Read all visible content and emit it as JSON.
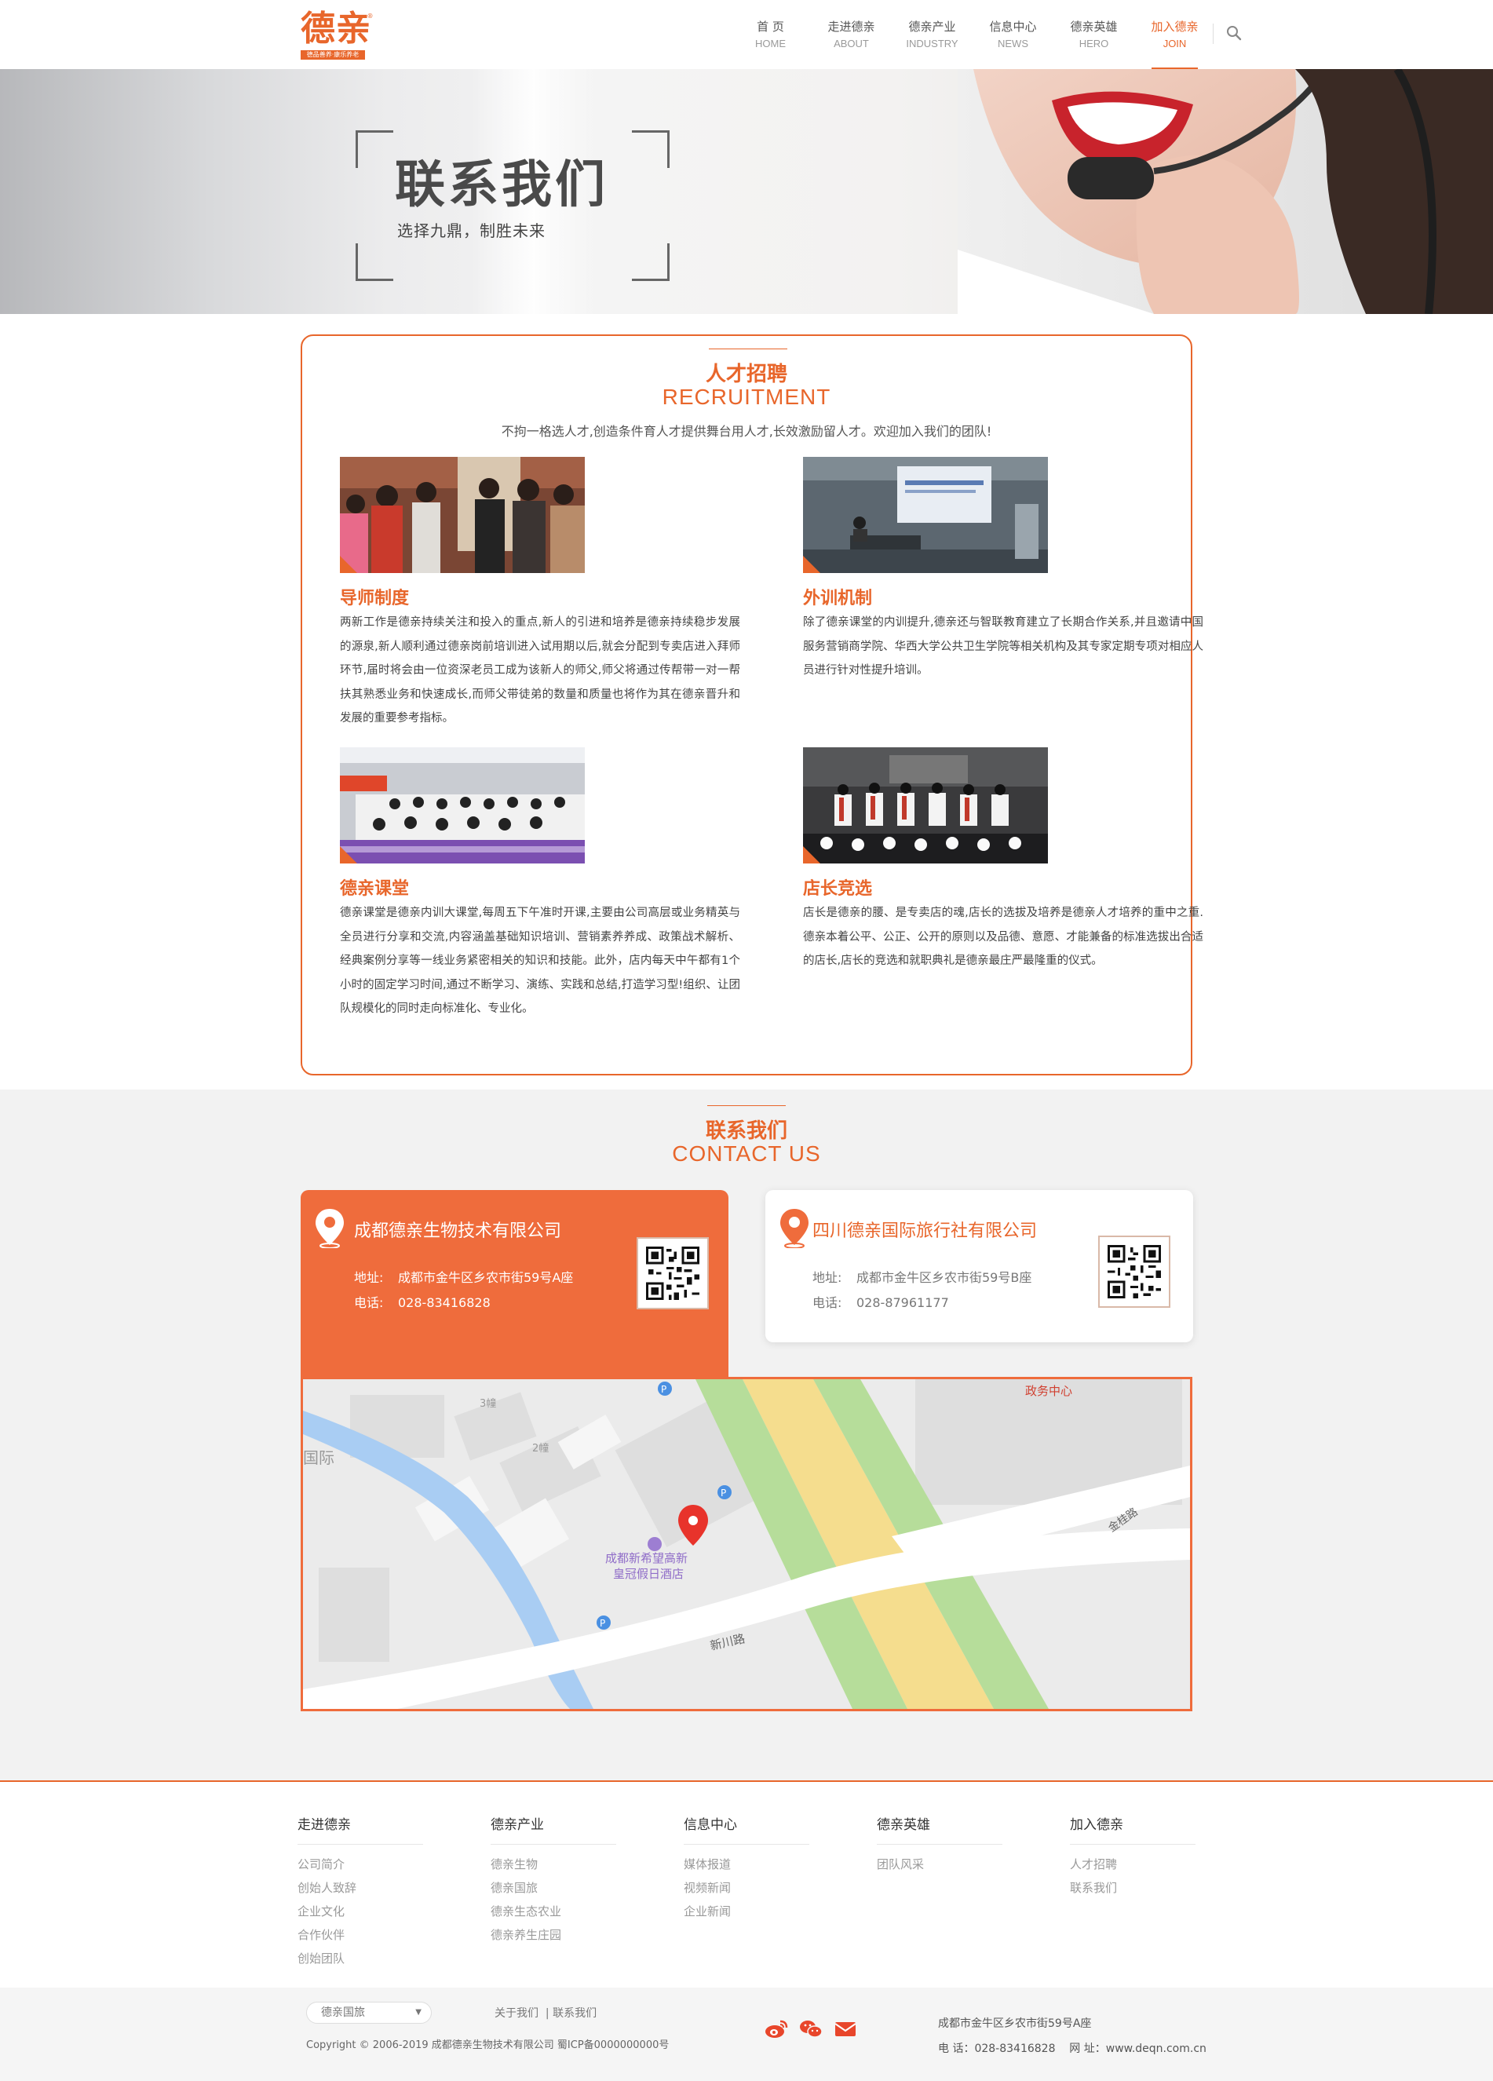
{
  "header": {
    "logo_text": "德亲",
    "logo_tagline": "德品善养·康乐养老",
    "logo_reg": "®",
    "nav": [
      {
        "cn": "首 页",
        "en": "HOME"
      },
      {
        "cn": "走进德亲",
        "en": "ABOUT"
      },
      {
        "cn": "德亲产业",
        "en": "INDUSTRY"
      },
      {
        "cn": "信息中心",
        "en": "NEWS"
      },
      {
        "cn": "德亲英雄",
        "en": "HERO"
      },
      {
        "cn": "加入德亲",
        "en": "JOIN"
      }
    ],
    "active_nav": "JOIN"
  },
  "banner": {
    "title": "联系我们",
    "subtitle": "选择九鼎，制胜未来"
  },
  "recruitment": {
    "title_cn": "人才招聘",
    "title_en": "RECRUITMENT",
    "description": "不拘一格选人才,创造条件育人才提供舞台用人才,长效激励留人才。欢迎加入我们的团队!",
    "items": [
      {
        "title": "导师制度",
        "text": "两新工作是德亲持续关注和投入的重点,新人的引进和培养是德亲持续稳步发展的源泉,新人顺利通过德亲岗前培训进入试用期以后,就会分配到专卖店进入拜师环节,届时将会由一位资深老员工成为该新人的师父,师父将通过传帮带一对一帮扶其熟悉业务和快速成长,而师父带徒弟的数量和质量也将作为其在德亲晋升和发展的重要参考指标。"
      },
      {
        "title": "外训机制",
        "text": "除了德亲课堂的内训提升,德亲还与智联教育建立了长期合作关系,并且邀请中国服务营销商学院、华西大学公共卫生学院等相关机构及其专家定期专项对相应人员进行针对性提升培训。"
      },
      {
        "title": "德亲课堂",
        "text": "德亲课堂是德亲内训大课堂,每周五下午准时开课,主要由公司高层或业务精英与全员进行分享和交流,内容涵盖基础知识培训、营销素养养成、政策战术解析、经典案例分享等一线业务紧密相关的知识和技能。此外，店内每天中午都有1个小时的固定学习时间,通过不断学习、演练、实践和总结,打造学习型!组织、让团队规模化的同时走向标准化、专业化。"
      },
      {
        "title": "店长竞选",
        "text": "店长是德亲的腰、是专卖店的魂,店长的选拔及培养是德亲人才培养的重中之重.德亲本着公平、公正、公开的原则以及品德、意愿、才能兼备的标准选拔出合适的店长,店长的竞选和就职典礼是德亲最庄严最隆重的仪式。"
      }
    ]
  },
  "contact": {
    "title_cn": "联系我们",
    "title_en": "CONTACT US",
    "companies": [
      {
        "name": "成都德亲生物技术有限公司",
        "address_label": "地址:",
        "address": "成都市金牛区乡农市街59号A座",
        "phone_label": "电话:",
        "phone": "028-83416828"
      },
      {
        "name": "四川德亲国际旅行社有限公司",
        "address_label": "地址:",
        "address": "成都市金牛区乡农市街59号B座",
        "phone_label": "电话:",
        "phone": "028-87961177"
      }
    ],
    "map": {
      "poi_name_line1": "成都新希望高新",
      "poi_name_line2": "皇冠假日酒店",
      "label_top_right_1": "政务中心",
      "label_left": "国际",
      "label_road_1": "新川路",
      "label_road_2": "金桂路",
      "label_bldg_3": "3幢",
      "label_bldg_2": "2幢"
    }
  },
  "footer": {
    "columns": [
      {
        "title": "走进德亲",
        "items": [
          "公司简介",
          "创始人致辞",
          "企业文化",
          "合作伙伴",
          "创始团队"
        ]
      },
      {
        "title": "德亲产业",
        "items": [
          "德亲生物",
          "德亲国旅",
          "德亲生态农业",
          "德亲养生庄园"
        ]
      },
      {
        "title": "信息中心",
        "items": [
          "媒体报道",
          "视频新闻",
          "企业新闻"
        ]
      },
      {
        "title": "德亲英雄",
        "items": [
          "团队风采"
        ]
      },
      {
        "title": "加入德亲",
        "items": [
          "人才招聘",
          "联系我们"
        ]
      }
    ],
    "select_value": "德亲国旅",
    "links": [
      "关于我们",
      "联系我们"
    ],
    "copyright": "Copyright © 2006-2019 成都德亲生物技术有限公司  蜀ICP备0000000000号",
    "address": "成都市金牛区乡农市街59号A座",
    "phone_label": "电 话：",
    "phone": "028-83416828",
    "web_label": "网 址：",
    "website": "www.deqn.com.cn",
    "social_icons": [
      "weibo-icon",
      "wechat-icon",
      "email-icon"
    ]
  },
  "colors": {
    "accent": "#e8662b",
    "card_orange": "#ef6c3c",
    "contact_bg": "#f2f2f2"
  }
}
